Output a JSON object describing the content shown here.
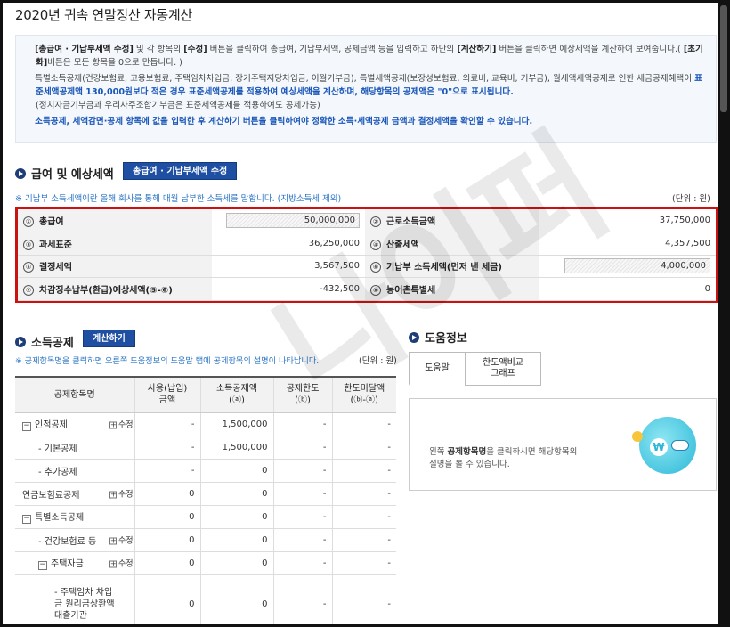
{
  "page_title": "2020년 귀속 연말정산 자동계산",
  "notice": {
    "p1_bold1": "[총급여 · 기납부세액 수정]",
    "p1_text1": " 및 각 항목의 ",
    "p1_bold2": "[수정]",
    "p1_text2": " 버튼을 클릭하여 총급여, 기납부세액, 공제금액 등을 입력하고 하단의 ",
    "p1_bold3": "[계산하기]",
    "p1_text3": " 버튼을 클릭하면 예상세액을 계산하여 보여줍니다.( ",
    "p1_bold4": "[초기화]",
    "p1_text4": "버튼은 모든 항목을 0으로 만듭니다. )",
    "p2_text1": "특별소득공제(건강보험료, 고용보험료, 주택임차차입금, 장기주택저당차입금, 이월기부금), 특별세액공제(보장성보험료, 의료비, 교육비, 기부금), 월세액세액공제로 인한 세금공제혜택이 ",
    "p2_blue": "표준세액공제액 130,000원보다 적은 경우 표준세액공제를 적용하여 예상세액을 계산하며, 해당항목의 공제액은 \"0\"으로 표시됩니다.",
    "p2_text2": "(정치자금기부금과 우리사주조합기부금은 표준세액공제를 적용하여도 공제가능)",
    "p3_blue": "소득공제, 세액감면·공제 항목에 값을 입력한 후 계산하기 버튼을 클릭하여야 정확한 소득·세액공제 금액과 결정세액을 확인할 수 있습니다."
  },
  "salary_section": {
    "title": "급여 및 예상세액",
    "edit_button": "총급여 · 기납부세액 수정",
    "note": "※ 기납부 소득세액이란 올해 회사를 통해 매월 납부한 소득세를 말합니다. (지방소득세 제외)",
    "unit": "(단위 : 원)",
    "rows": [
      {
        "n1": "①",
        "l1": "총급여",
        "v1": "50,000,000",
        "n2": "②",
        "l2": "근로소득금액",
        "v2": "37,750,000"
      },
      {
        "n1": "③",
        "l1": "과세표준",
        "v1": "36,250,000",
        "n2": "④",
        "l2": "산출세액",
        "v2": "4,357,500"
      },
      {
        "n1": "⑤",
        "l1": "결정세액",
        "v1": "3,567,500",
        "n2": "⑥",
        "l2": "기납부 소득세액(먼저 낸 세금)",
        "v2": "4,000,000"
      },
      {
        "n1": "⑦",
        "l1": "차감징수납부(환급)예상세액(⑤-⑥)",
        "v1": "-432,500",
        "n2": "⑧",
        "l2": "농어촌특별세",
        "v2": "0"
      }
    ]
  },
  "income_section": {
    "title": "소득공제",
    "calc_button": "계산하기",
    "note": "※ 공제항목명을 클릭하면 오른쪽 도움정보의 도움말 탭에 공제항목의 설명이 나타납니다.",
    "unit": "(단위 : 원)",
    "headers": [
      "공제항목명",
      "사용(납입)\n금액",
      "소득공제액\n(ⓐ)",
      "공제한도\n(ⓑ)",
      "한도미달액\n(ⓑ-ⓐ)"
    ],
    "edit_label": "수정",
    "rows": [
      {
        "name": "인적공제",
        "edit": true,
        "collapse": true,
        "indent": 0,
        "used": "-",
        "amount": "1,500,000",
        "limit": "-",
        "under": "-"
      },
      {
        "name": "- 기본공제",
        "edit": false,
        "collapse": false,
        "indent": 1,
        "used": "-",
        "amount": "1,500,000",
        "limit": "-",
        "under": "-"
      },
      {
        "name": "- 추가공제",
        "edit": false,
        "collapse": false,
        "indent": 1,
        "used": "-",
        "amount": "0",
        "limit": "-",
        "under": "-"
      },
      {
        "name": "연금보험료공제",
        "edit": true,
        "collapse": false,
        "indent": 0,
        "used": "0",
        "amount": "0",
        "limit": "-",
        "under": "-"
      },
      {
        "name": "특별소득공제",
        "edit": false,
        "collapse": true,
        "indent": 0,
        "used": "0",
        "amount": "0",
        "limit": "-",
        "under": "-"
      },
      {
        "name": "- 건강보험료 등",
        "edit": true,
        "collapse": false,
        "indent": 1,
        "used": "0",
        "amount": "0",
        "limit": "-",
        "under": "-"
      },
      {
        "name": "주택자금",
        "edit": true,
        "collapse": true,
        "indent": 1,
        "used": "0",
        "amount": "0",
        "limit": "-",
        "under": "-"
      },
      {
        "name": "- 주택임차 차입금 원리금상환액 대출기관",
        "edit": false,
        "collapse": false,
        "indent": 2,
        "used": "0",
        "amount": "0",
        "limit": "-",
        "under": "-"
      }
    ]
  },
  "help_section": {
    "title": "도움정보",
    "tabs": [
      "도움말",
      "한도액비교\n그래프"
    ],
    "text_bold": "공제항목명",
    "text_pre": "왼쪽 ",
    "text_post": "을 클릭하시면 해당항목의",
    "text_line2": "설명을 볼 수 있습니다."
  },
  "icons": {
    "section_bullet": "circle-arrow-icon",
    "collapse": "minus-box-icon",
    "expand_edit": "plus-box-icon",
    "help_illustration": "coin-character-icon"
  },
  "colors": {
    "primary_button": "#1f4fa2",
    "highlight_box": "#cc1111",
    "note_text": "#2a74c4"
  }
}
